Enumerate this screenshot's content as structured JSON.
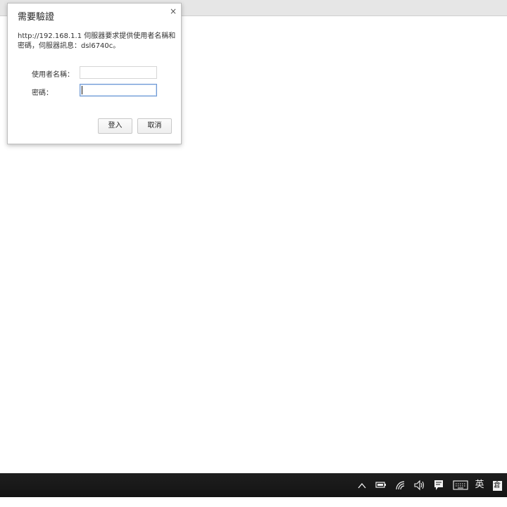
{
  "dialog": {
    "title": "需要驗證",
    "close_glyph": "×",
    "message": "http://192.168.1.1 伺服器要求提供使用者名稱和密碼，伺服器訊息：dsl6740c。",
    "username_label": "使用者名稱：",
    "password_label": "密碼：",
    "username_value": "",
    "password_value": "",
    "login_label": "登入",
    "cancel_label": "取消"
  },
  "taskbar": {
    "tray_icons": [
      "chevron-up-icon",
      "battery-icon",
      "wifi-icon",
      "speaker-icon",
      "action-center-icon",
      "keyboard-icon",
      "ime-indicator",
      "ime-mode-icon"
    ],
    "ime_label": "英",
    "ime_mode_glyph": "倉"
  },
  "colors": {
    "taskbar": "#1a1a1a",
    "focus_border": "#6f99d4"
  }
}
